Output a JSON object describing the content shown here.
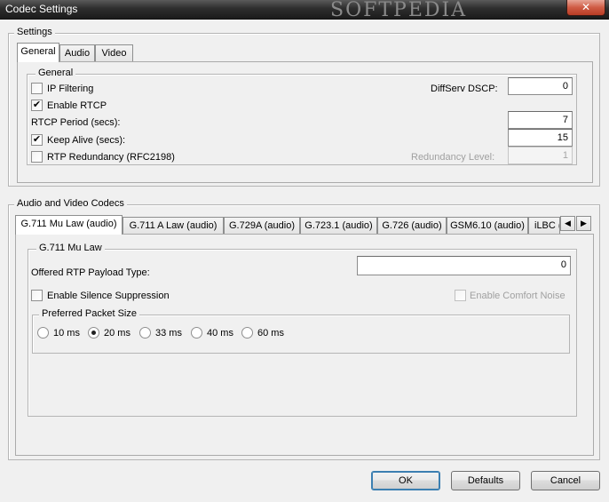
{
  "window": {
    "title": "Codec Settings",
    "watermark": "SOFTPEDIA",
    "close_glyph": "✕"
  },
  "settings": {
    "group_label": "Settings",
    "tabs": [
      {
        "label": "General",
        "active": true
      },
      {
        "label": "Audio",
        "active": false
      },
      {
        "label": "Video",
        "active": false
      }
    ],
    "general": {
      "group_label": "General",
      "ip_filtering": {
        "label": "IP Filtering",
        "checked": false
      },
      "enable_rtcp": {
        "label": "Enable RTCP",
        "checked": true
      },
      "rtcp_period": {
        "label": "RTCP Period (secs):",
        "value": "7"
      },
      "keep_alive": {
        "label": "Keep Alive (secs):",
        "checked": true,
        "value": "15"
      },
      "rtp_redundancy": {
        "label": "RTP Redundancy (RFC2198)",
        "checked": false
      },
      "diffserv": {
        "label": "DiffServ DSCP:",
        "value": "0"
      },
      "redundancy_level": {
        "label": "Redundancy Level:",
        "value": "1",
        "enabled": false
      }
    }
  },
  "codecs": {
    "group_label": "Audio and Video Codecs",
    "tabs": [
      {
        "label": "G.711 Mu Law (audio)",
        "active": true
      },
      {
        "label": "G.711 A Law (audio)",
        "active": false
      },
      {
        "label": "G.729A (audio)",
        "active": false
      },
      {
        "label": "G.723.1 (audio)",
        "active": false
      },
      {
        "label": "G.726 (audio)",
        "active": false
      },
      {
        "label": "GSM6.10 (audio)",
        "active": false
      },
      {
        "label": "iLBC (a",
        "active": false
      }
    ],
    "scroll_left_glyph": "◀",
    "scroll_right_glyph": "▶",
    "panel": {
      "group_label": "G.711 Mu Law",
      "payload_type": {
        "label": "Offered RTP Payload Type:",
        "value": "0"
      },
      "silence_suppression": {
        "label": "Enable Silence Suppression",
        "checked": false
      },
      "comfort_noise": {
        "label": "Enable Comfort Noise",
        "checked": false,
        "enabled": false
      },
      "packet_size": {
        "group_label": "Preferred Packet Size",
        "options": [
          "10 ms",
          "20 ms",
          "33 ms",
          "40 ms",
          "60 ms"
        ],
        "selected": "20 ms"
      }
    }
  },
  "buttons": {
    "ok": "OK",
    "defaults": "Defaults",
    "cancel": "Cancel"
  },
  "check_glyph": "✔"
}
